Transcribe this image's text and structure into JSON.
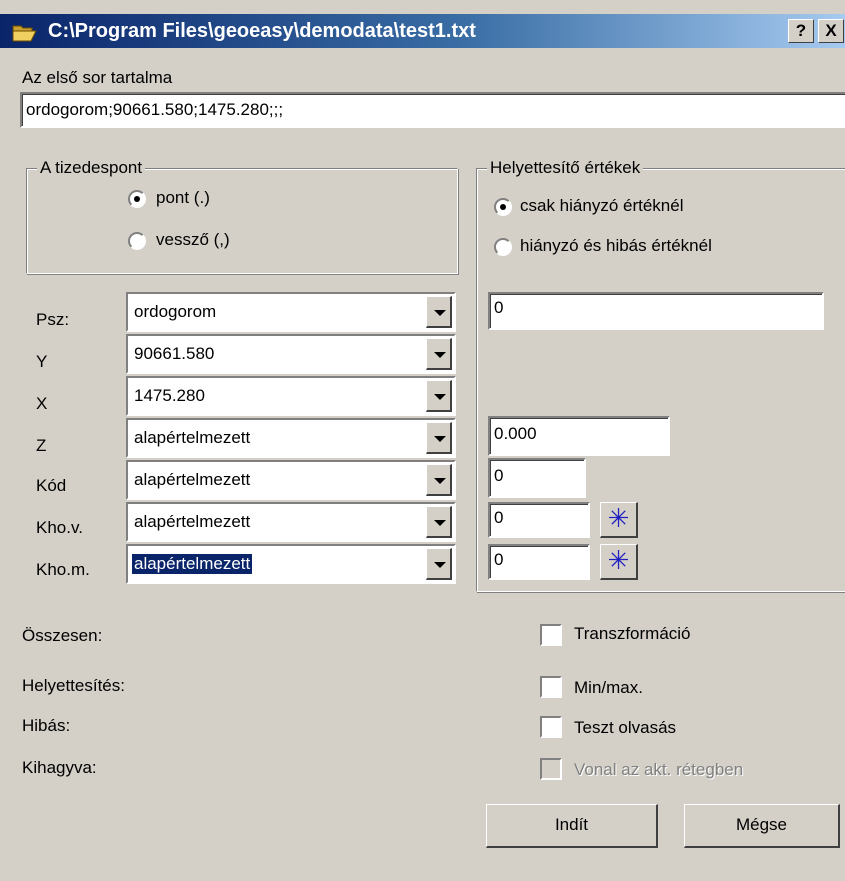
{
  "window": {
    "title": "C:\\Program Files\\geoeasy\\demodata\\test1.txt",
    "help_label": "?",
    "close_label": "X"
  },
  "first_line": {
    "label": "Az első sor tartalma",
    "value": "ordogorom;90661.580;1475.280;;;"
  },
  "decimal_point": {
    "title": "A tizedespont",
    "options": [
      {
        "label": "pont (.)",
        "selected": true
      },
      {
        "label": "vessző (,)",
        "selected": false
      }
    ]
  },
  "substitute": {
    "title": "Helyettesítő értékek",
    "options": [
      {
        "label": "csak hiányzó értéknél",
        "selected": true
      },
      {
        "label": "hiányzó és hibás értéknél",
        "selected": false
      }
    ]
  },
  "fields": [
    {
      "label": "Psz:",
      "selected": "ordogorom",
      "default": "0"
    },
    {
      "label": "Y",
      "selected": "90661.580",
      "default": ""
    },
    {
      "label": "X",
      "selected": "1475.280",
      "default": ""
    },
    {
      "label": "Z",
      "selected": "alapértelmezett",
      "default": "0.000"
    },
    {
      "label": "Kód",
      "selected": "alapértelmezett",
      "default": "0"
    },
    {
      "label": "Kho.v.",
      "selected": "alapértelmezett",
      "default": "0"
    },
    {
      "label": "Kho.m.",
      "selected": "alapértelmezett",
      "default": "0"
    }
  ],
  "star_icon": "✳",
  "stats": {
    "total": "Összesen:",
    "substituted": "Helyettesítés:",
    "errors": "Hibás:",
    "skipped": "Kihagyva:"
  },
  "options": {
    "transform": "Transzformáció",
    "minmax": "Min/max.",
    "test_read": "Teszt olvasás",
    "line_layer": "Vonal  az akt. rétegben"
  },
  "buttons": {
    "start": "Indít",
    "cancel": "Mégse"
  }
}
